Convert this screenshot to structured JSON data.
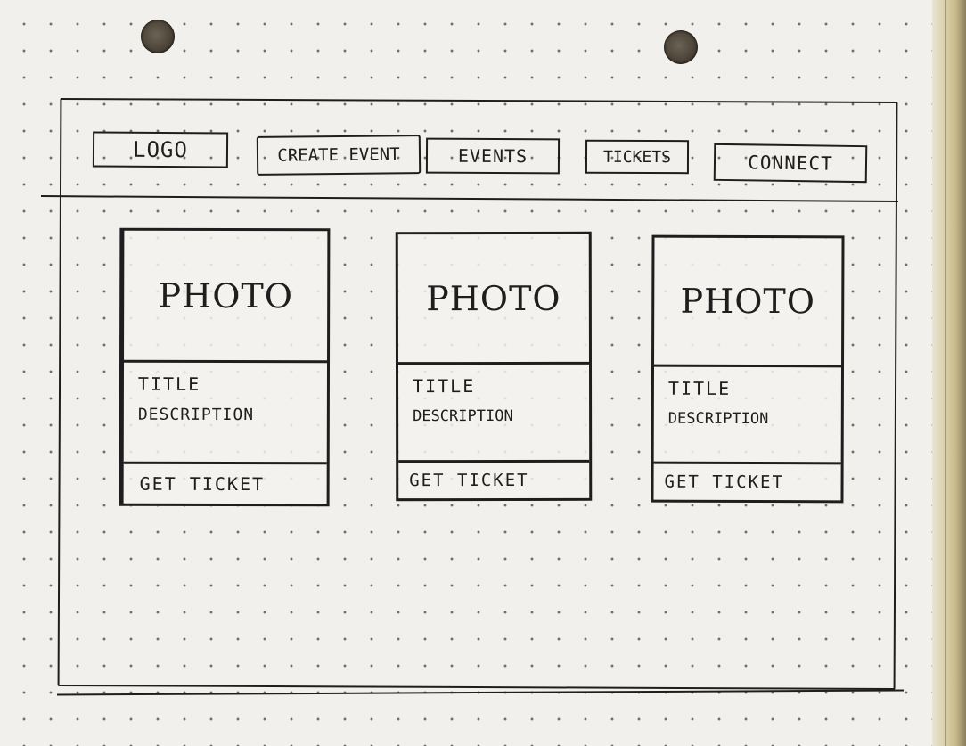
{
  "header": {
    "logo": "LOGO",
    "nav": {
      "create_event": "CREATE EVENT",
      "events": "EVENTS",
      "tickets": "TICKETS",
      "connect": "CONNECT"
    }
  },
  "cards": [
    {
      "photo": "PHOTO",
      "title": "TITLE",
      "description": "DESCRIPTION",
      "cta": "GET TICKET"
    },
    {
      "photo": "PHOTO",
      "title": "TITLE",
      "description": "DESCRIPTION",
      "cta": "GET TICKET"
    },
    {
      "photo": "PHOTO",
      "title": "TITLE",
      "description": "DESCRIPTION",
      "cta": "GET TICKET"
    }
  ]
}
